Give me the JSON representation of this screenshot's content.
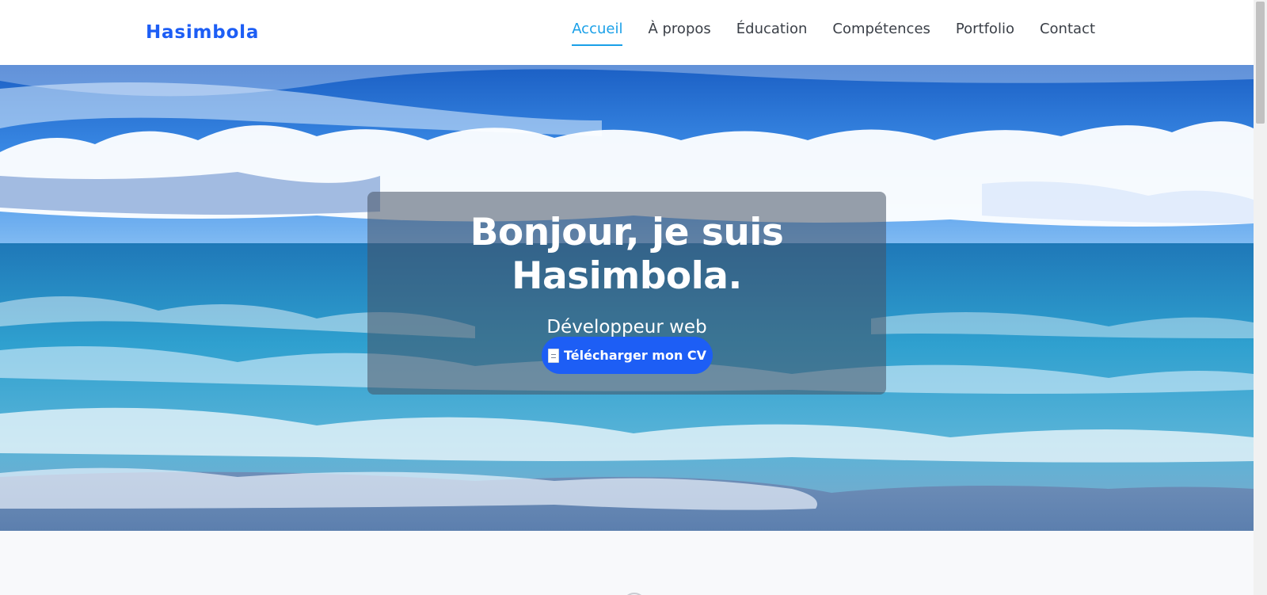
{
  "navbar": {
    "brand": "Hasimbola",
    "items": [
      {
        "label": "Accueil",
        "active": true
      },
      {
        "label": "À propos",
        "active": false
      },
      {
        "label": "Éducation",
        "active": false
      },
      {
        "label": "Compétences",
        "active": false
      },
      {
        "label": "Portfolio",
        "active": false
      },
      {
        "label": "Contact",
        "active": false
      }
    ]
  },
  "hero": {
    "title": "Bonjour, je suis Hasimbola.",
    "subtitle": "Développeur web",
    "cv_button_label": "Télécharger mon CV",
    "cv_button_icon": "document-icon"
  },
  "colors": {
    "brand": "#1d5ef5",
    "nav_active": "#1aa0e8",
    "nav_text": "#3a3f47"
  }
}
